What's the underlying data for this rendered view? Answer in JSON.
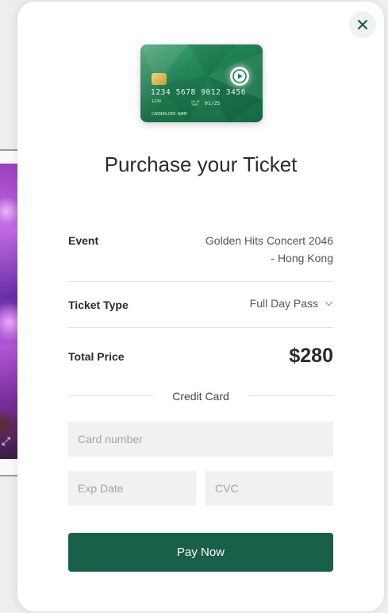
{
  "colors": {
    "accent": "#18604a",
    "input_bg": "#f1f1f1",
    "card_green": "#1e8052"
  },
  "icons": {
    "close": "close-icon",
    "dropdown": "chevron-down-icon",
    "expand": "expand-icon",
    "card_logo": "play-icon"
  },
  "card": {
    "number": "1234 5678 9012 3456",
    "small_number": "1234",
    "valid_label": "VALID THRU",
    "expiry": "01/25",
    "holder": "CARDHOLDER NAME"
  },
  "modal": {
    "title": "Purchase your Ticket",
    "event_label": "Event",
    "event_value_line1": "Golden Hits Concert 2046",
    "event_value_line2": "- Hong Kong",
    "ticket_type_label": "Ticket Type",
    "ticket_type_value": "Full Day Pass",
    "total_label": "Total Price",
    "total_value": "$280",
    "credit_card_heading": "Credit Card",
    "card_number_placeholder": "Card number",
    "exp_date_placeholder": "Exp Date",
    "cvc_placeholder": "CVC",
    "pay_button": "Pay Now"
  }
}
